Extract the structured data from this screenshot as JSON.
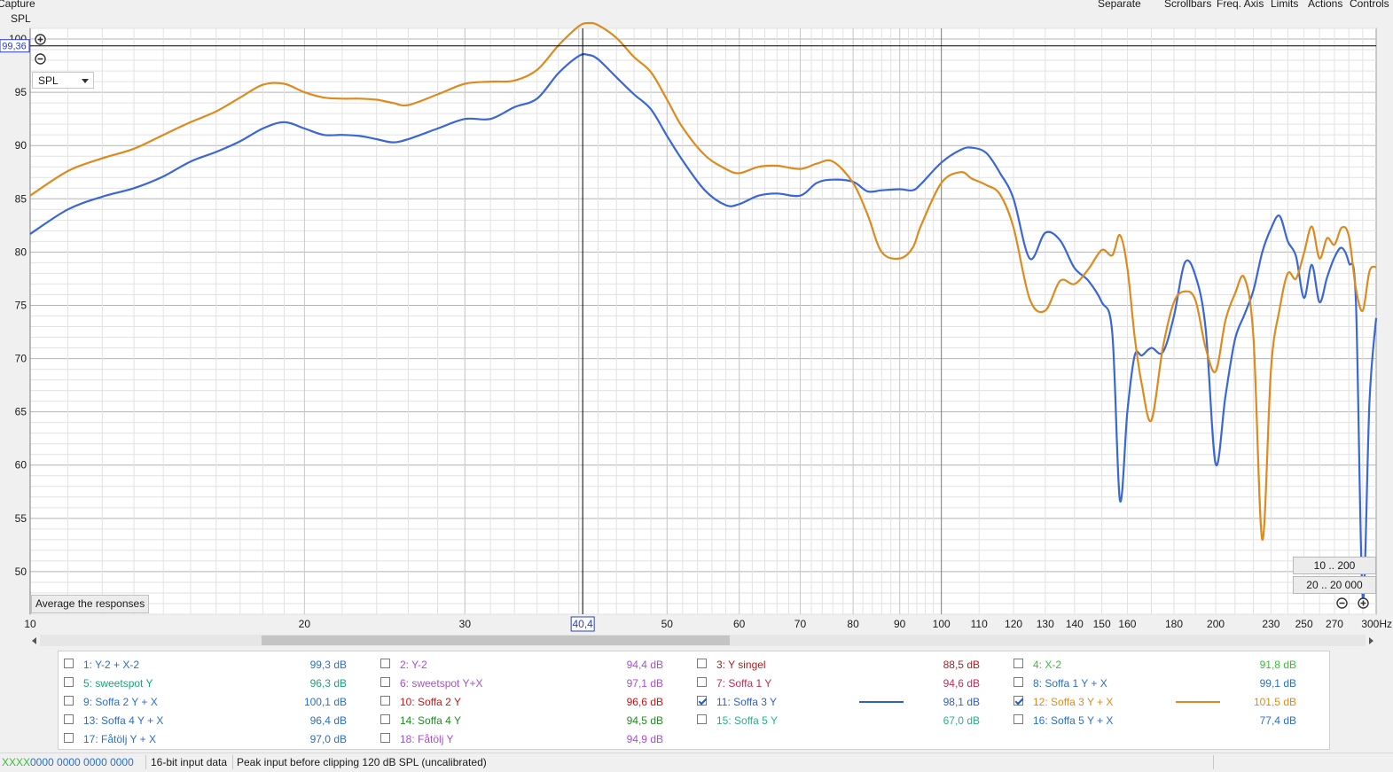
{
  "toolbar": {
    "capture": "Capture",
    "separate": "Separate",
    "scrollbars": "Scrollbars",
    "freq_axis": "Freq. Axis",
    "limits": "Limits",
    "actions": "Actions",
    "controls": "Controls"
  },
  "graph_type_label": "SPL",
  "graph_select_value": "SPL",
  "cursor": {
    "y_readout": "99,36",
    "x_readout": "40,4"
  },
  "buttons": {
    "average": "Average the responses",
    "range_1": "10 .. 200",
    "range_2": "20 .. 20 000"
  },
  "colors": {
    "series_blue": "#3a66d6",
    "series_orange": "#dd8a1e",
    "grid_major": "#b4b4b4",
    "grid_minor": "#e2e2e2"
  },
  "legend": [
    {
      "id": "1",
      "name": "1: Y-2 + X-2",
      "value": "99,3 dB",
      "color": "#2a6fd0",
      "checked": false
    },
    {
      "id": "2",
      "name": "2: Y-2",
      "value": "94,4 dB",
      "color": "#a64fd3",
      "checked": false
    },
    {
      "id": "3",
      "name": "3: Y singel",
      "value": "88,5 dB",
      "color": "#b31b1b",
      "checked": false
    },
    {
      "id": "4",
      "name": "4: X-2",
      "value": "91,8 dB",
      "color": "#3bbd3b",
      "checked": false
    },
    {
      "id": "5",
      "name": "5: sweetspot Y",
      "value": "96,3 dB",
      "color": "#1aa37a",
      "checked": false
    },
    {
      "id": "6",
      "name": "6: sweetspot Y+X",
      "value": "97,1 dB",
      "color": "#a64fd3",
      "checked": false
    },
    {
      "id": "7",
      "name": "7: Soffa 1 Y",
      "value": "94,6 dB",
      "color": "#c42b55",
      "checked": false
    },
    {
      "id": "8",
      "name": "8: Soffa 1 Y + X",
      "value": "99,1 dB",
      "color": "#2a6fd0",
      "checked": false
    },
    {
      "id": "9",
      "name": "9: Soffa 2 Y + X",
      "value": "100,1 dB",
      "color": "#2a6fd0",
      "checked": false
    },
    {
      "id": "10",
      "name": "10: Soffa 2 Y",
      "value": "96,6 dB",
      "color": "#c01818",
      "checked": false
    },
    {
      "id": "11",
      "name": "11: Soffa 3 Y",
      "value": "98,1 dB",
      "color": "#2f5fcf",
      "checked": true
    },
    {
      "id": "12",
      "name": "12: Soffa 3 Y + X",
      "value": "101,5 dB",
      "color": "#dd8a1e",
      "checked": true
    },
    {
      "id": "13",
      "name": "13: Soffa 4 Y + X",
      "value": "96,4 dB",
      "color": "#2a6fd0",
      "checked": false
    },
    {
      "id": "14",
      "name": "14: Soffa 4 Y",
      "value": "94,5 dB",
      "color": "#1f8c1f",
      "checked": false
    },
    {
      "id": "15",
      "name": "15: Soffa 5 Y",
      "value": "67,0 dB",
      "color": "#2ab08a",
      "checked": false
    },
    {
      "id": "16",
      "name": "16: Soffa 5 Y + X",
      "value": "77,4 dB",
      "color": "#2a6fd0",
      "checked": false
    },
    {
      "id": "17",
      "name": "17: Fåtölj Y + X",
      "value": "97,0 dB",
      "color": "#2a6fd0",
      "checked": false
    },
    {
      "id": "18",
      "name": "18: Fåtölj Y",
      "value": "94,9 dB",
      "color": "#a64fd3",
      "checked": false
    }
  ],
  "status": {
    "meter": "XXXX",
    "codes": "0000 0000  0000 0000",
    "input": "16-bit input data",
    "peak": "Peak input before clipping 120 dB SPL (uncalibrated)"
  },
  "chart_data": {
    "type": "line",
    "xscale": "log",
    "xlim": [
      10,
      300
    ],
    "ylim": [
      46,
      101
    ],
    "x_ticks": [
      10,
      20,
      30,
      40.4,
      50,
      60,
      70,
      80,
      90,
      100,
      110,
      120,
      130,
      140,
      150,
      160,
      180,
      200,
      230,
      250,
      270
    ],
    "x_tick_labels": [
      "10",
      "20",
      "30",
      "40,4",
      "50",
      "60",
      "70",
      "80",
      "90",
      "100",
      "110",
      "120",
      "130",
      "140",
      "150",
      "160",
      "180",
      "200",
      "230",
      "250",
      "270"
    ],
    "x_end_label": "300Hz",
    "y_ticks": [
      50,
      55,
      60,
      65,
      70,
      75,
      80,
      85,
      90,
      95
    ],
    "y_top_label": "100",
    "grid": true,
    "cursor": {
      "x": 40.4,
      "y": 99.36
    },
    "series": [
      {
        "name": "11: Soffa 3 Y",
        "color": "#3a66d6",
        "x": [
          10,
          11,
          12,
          13,
          14,
          15,
          16,
          17,
          18,
          19,
          20,
          21,
          22,
          23,
          24,
          25,
          26,
          28,
          30,
          32,
          34,
          36,
          38,
          40,
          41,
          42,
          44,
          46,
          48,
          50,
          52,
          55,
          58,
          60,
          63,
          66,
          70,
          73,
          76,
          80,
          83,
          86,
          90,
          93,
          95,
          100,
          105,
          108,
          112,
          116,
          120,
          125,
          130,
          135,
          140,
          145,
          150,
          154,
          157,
          160,
          163,
          166,
          170,
          175,
          180,
          185,
          190,
          195,
          200,
          205,
          210,
          215,
          220,
          225,
          230,
          235,
          240,
          245,
          250,
          255,
          260,
          265,
          270,
          275,
          280,
          285,
          290,
          295,
          300
        ],
        "y": [
          81.7,
          84.0,
          85.2,
          86.0,
          87.1,
          88.5,
          89.4,
          90.4,
          91.6,
          92.2,
          91.6,
          91.0,
          91.0,
          90.9,
          90.6,
          90.3,
          90.6,
          91.6,
          92.5,
          92.5,
          93.6,
          94.4,
          96.8,
          98.4,
          98.5,
          98.1,
          96.4,
          94.8,
          93.4,
          90.9,
          88.6,
          85.8,
          84.4,
          84.5,
          85.3,
          85.5,
          85.3,
          86.5,
          86.8,
          86.6,
          85.7,
          85.8,
          85.9,
          85.8,
          86.4,
          88.4,
          89.6,
          89.8,
          89.3,
          87.4,
          85.0,
          79.4,
          81.8,
          81.1,
          78.5,
          77.3,
          75.3,
          72.4,
          56.7,
          65.0,
          70.3,
          70.3,
          71.0,
          70.6,
          74.0,
          79.0,
          77.8,
          72.8,
          60.1,
          66.5,
          71.8,
          74.1,
          76.4,
          80.0,
          82.2,
          83.4,
          81.0,
          79.6,
          75.7,
          78.8,
          75.3,
          77.6,
          79.5,
          80.4,
          79.0,
          75.5,
          47.5,
          66.0,
          73.8
        ]
      },
      {
        "name": "12: Soffa 3 Y + X",
        "color": "#dd8a1e",
        "x": [
          10,
          11,
          12,
          13,
          14,
          15,
          16,
          17,
          18,
          19,
          20,
          21,
          22,
          23,
          24,
          25,
          26,
          28,
          30,
          32,
          34,
          36,
          38,
          40,
          41,
          42,
          44,
          46,
          48,
          50,
          52,
          55,
          58,
          60,
          63,
          66,
          70,
          73,
          76,
          80,
          83,
          86,
          90,
          93,
          95,
          100,
          105,
          108,
          112,
          116,
          120,
          125,
          130,
          135,
          140,
          145,
          150,
          154,
          157,
          160,
          163,
          166,
          170,
          175,
          180,
          185,
          190,
          195,
          200,
          205,
          210,
          215,
          220,
          225,
          230,
          235,
          240,
          245,
          250,
          255,
          260,
          265,
          270,
          275,
          280,
          285,
          290,
          295,
          300
        ],
        "y": [
          85.3,
          87.6,
          88.8,
          89.7,
          91.0,
          92.2,
          93.2,
          94.5,
          95.7,
          95.8,
          95.0,
          94.5,
          94.4,
          94.4,
          94.3,
          94.0,
          93.8,
          94.8,
          95.8,
          96.0,
          96.1,
          97.1,
          99.4,
          101.2,
          101.5,
          101.3,
          100.1,
          98.3,
          96.9,
          94.3,
          91.7,
          89.1,
          87.8,
          87.4,
          88.0,
          88.1,
          87.8,
          88.3,
          88.5,
          86.5,
          83.5,
          80.0,
          79.4,
          80.4,
          82.5,
          86.5,
          87.5,
          86.9,
          86.3,
          85.4,
          82.3,
          75.6,
          74.5,
          77.3,
          77.0,
          78.4,
          80.2,
          79.7,
          81.6,
          78.5,
          72.0,
          67.5,
          64.2,
          71.0,
          75.3,
          76.3,
          75.5,
          71.0,
          68.8,
          73.6,
          76.1,
          77.6,
          72.0,
          53.0,
          69.0,
          74.6,
          78.0,
          77.5,
          79.9,
          82.4,
          79.4,
          81.3,
          80.7,
          82.3,
          81.5,
          76.6,
          74.5,
          78.2,
          78.6
        ]
      }
    ]
  }
}
